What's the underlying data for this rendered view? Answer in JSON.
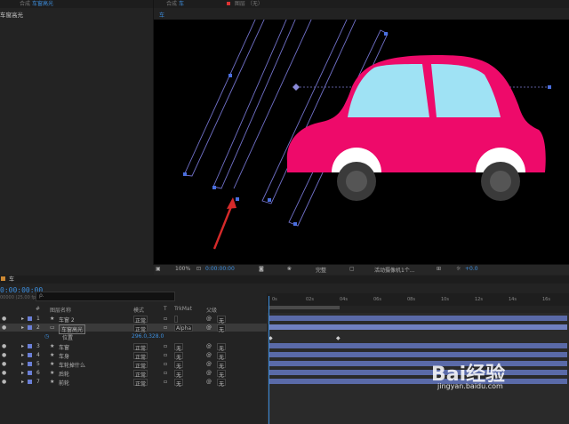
{
  "project_panel": {
    "tab_prefix": "合成",
    "tab_name": "车窗高光",
    "item": "车窗高光"
  },
  "comp_panel": {
    "tab1_prefix": "合成",
    "tab1_name": "车",
    "tab2_prefix": "图层",
    "tab2_name": "（无）",
    "breadcrumb": "车"
  },
  "viewer_bar": {
    "zoom": "100%",
    "timecode": "0:00:00:00",
    "resolution": "完整",
    "camera": "活动摄像机",
    "views": "1个...",
    "exposure": "+0.0"
  },
  "timeline": {
    "tab_title": "车",
    "timecode": "0:00:00:00",
    "fps": "00000 (25.00 fps)",
    "search_placeholder": "ρ.",
    "col_num": "#",
    "col_name": "图层名称",
    "col_mode": "模式",
    "col_t": "T",
    "col_trkmat": "TrkMat",
    "col_parent": "父级",
    "ruler_ticks": [
      "0s",
      "02s",
      "04s",
      "06s",
      "08s",
      "10s",
      "12s",
      "14s",
      "16s"
    ],
    "layers": [
      {
        "num": "1",
        "name": "车窗 2",
        "mode": "正常",
        "trk": "",
        "parent": "无",
        "color": "#6b7fd6",
        "icon": "star"
      },
      {
        "num": "2",
        "name": "车窗高光",
        "mode": "正常",
        "trk": "Alpha",
        "parent": "无",
        "color": "#6b7fd6",
        "icon": "rect",
        "selected": true
      },
      {
        "num": "3",
        "name": "车窗",
        "mode": "正常",
        "trk": "无",
        "parent": "无",
        "color": "#6b7fd6",
        "icon": "star"
      },
      {
        "num": "4",
        "name": "车身",
        "mode": "正常",
        "trk": "无",
        "parent": "无",
        "color": "#6b7fd6",
        "icon": "star"
      },
      {
        "num": "5",
        "name": "车轮掉什么",
        "mode": "正常",
        "trk": "无",
        "parent": "无",
        "color": "#6b7fd6",
        "icon": "star"
      },
      {
        "num": "6",
        "name": "后轮",
        "mode": "正常",
        "trk": "无",
        "parent": "无",
        "color": "#6b7fd6",
        "icon": "star"
      },
      {
        "num": "7",
        "name": "前轮",
        "mode": "正常",
        "trk": "无",
        "parent": "无",
        "color": "#6b7fd6",
        "icon": "star"
      }
    ],
    "position_label": "位置",
    "position_value": "296.0,328.0"
  },
  "watermark": {
    "brand": "Bai经验",
    "url": "jingyan.baidu.com"
  }
}
